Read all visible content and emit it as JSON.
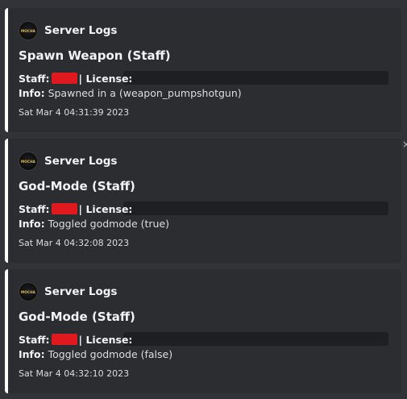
{
  "embeds": [
    {
      "author": "Server Logs",
      "avatar_text": "MOCHA",
      "title": "Spawn Weapon (Staff)",
      "staff_label": "Staff:",
      "license_label": "| License:",
      "info_label": "Info:",
      "info_text": "Spawned in a (weapon_pumpshotgun)",
      "timestamp": "Sat Mar  4 04:31:39 2023"
    },
    {
      "author": "Server Logs",
      "avatar_text": "MOCHA",
      "title": "God-Mode (Staff)",
      "staff_label": "Staff:",
      "license_label": "| License:",
      "info_label": "Info:",
      "info_text": "Toggled godmode (true)",
      "timestamp": "Sat Mar  4 04:32:08 2023"
    },
    {
      "author": "Server Logs",
      "avatar_text": "MOCHA",
      "title": "God-Mode (Staff)",
      "staff_label": "Staff:",
      "license_label": "| License:",
      "info_label": "Info:",
      "info_text": "Toggled godmode (false)",
      "timestamp": "Sat Mar  4 04:32:10 2023"
    }
  ],
  "close_glyph": "×",
  "colors": {
    "background": "#313338",
    "embed_background": "#2b2d31",
    "embed_border": "#ffffff",
    "redaction_red": "#e0191f",
    "redaction_dark": "#1e1f22"
  }
}
